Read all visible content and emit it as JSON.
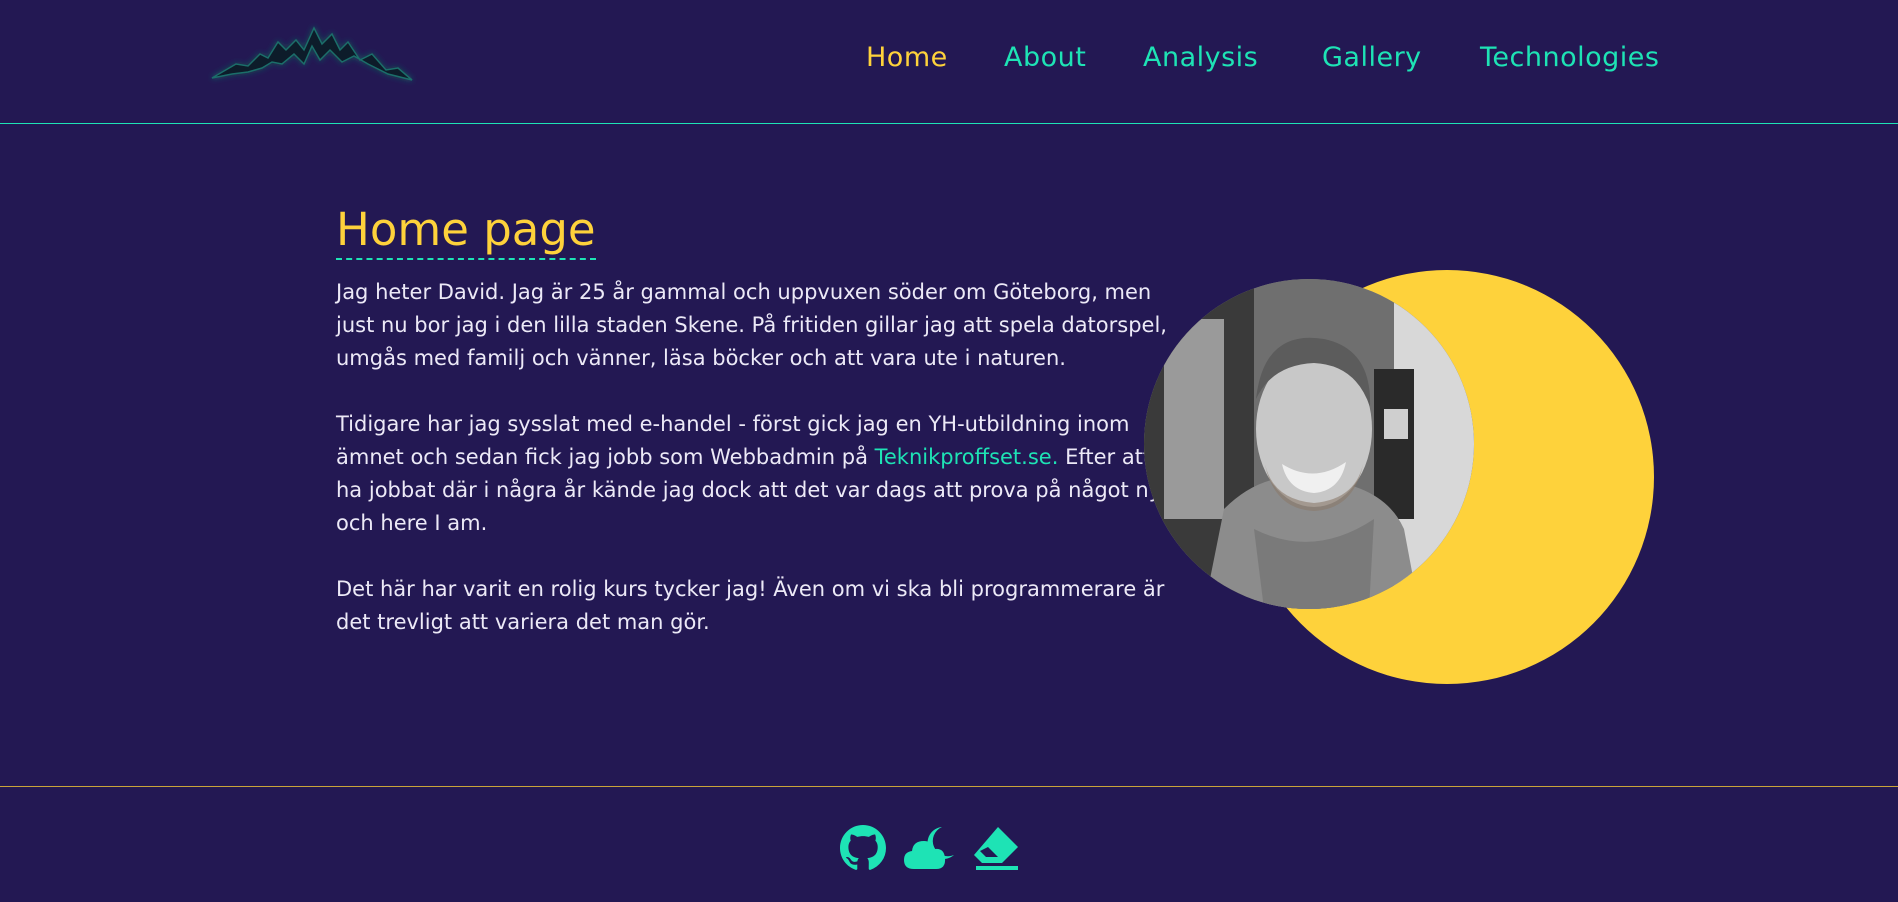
{
  "colors": {
    "background": "#231853",
    "accent": "#1ee3b5",
    "highlight": "#fed23b",
    "text": "#ece9f7"
  },
  "header": {
    "logo_icon": "mountain-range-icon",
    "nav": [
      {
        "label": "Home",
        "active": true
      },
      {
        "label": "About",
        "active": false
      },
      {
        "label": "Analysis",
        "active": false
      },
      {
        "label": "Gallery",
        "active": false
      },
      {
        "label": "Technologies",
        "active": false
      }
    ]
  },
  "main": {
    "title": "Home page",
    "paragraph1": "Jag heter David. Jag är 25 år gammal och uppvuxen söder om Göteborg, men just nu bor jag i den lilla staden Skene. På fritiden gillar jag att spela datorspel, umgås med familj och vänner, läsa böcker och att vara ute i naturen.",
    "paragraph2_before": "Tidigare har jag sysslat med e-handel - först gick jag en YH-utbildning inom ämnet och sedan fick jag jobb som Webbadmin på ",
    "paragraph2_link": "Teknikproffset.se.",
    "paragraph2_after": " Efter att ha jobbat där i några år kände jag dock att det var dags att prova på något nytt och here I am.",
    "paragraph3": "Det här har varit en rolig kurs tycker jag! Även om vi ska bli programmerare är det trevligt att variera det man gör."
  },
  "footer": {
    "icons": [
      "github-icon",
      "cloud-moon-icon",
      "eraser-icon"
    ]
  }
}
